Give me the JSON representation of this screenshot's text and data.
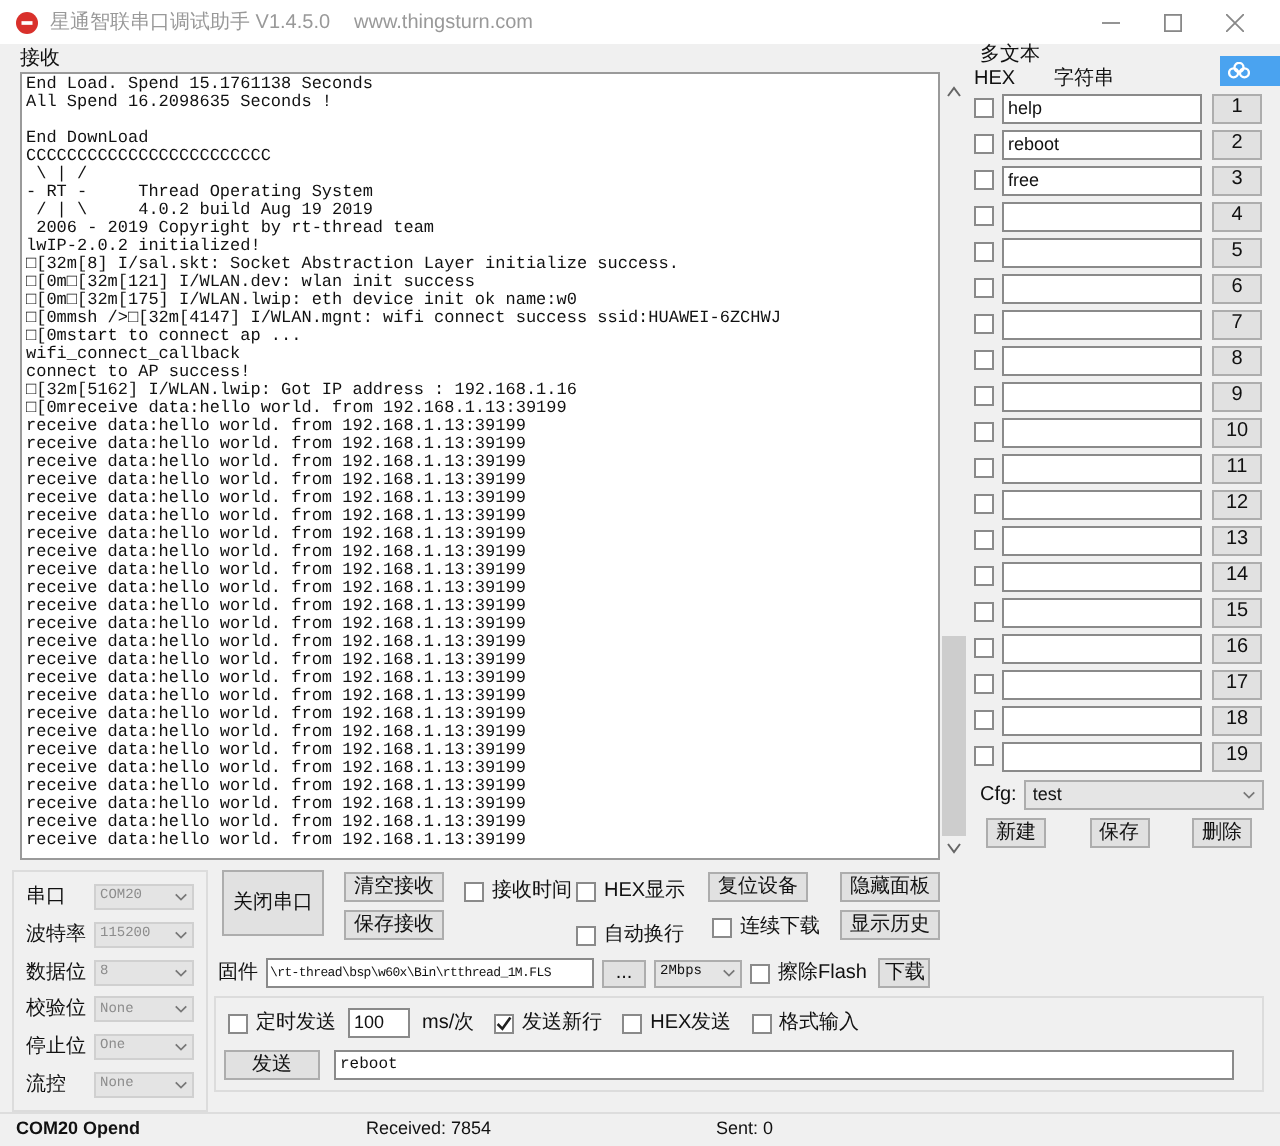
{
  "title_bar": {
    "title": "星通智联串口调试助手 V1.4.5.0",
    "url": "www.thingsturn.com"
  },
  "receive": {
    "label": "接收",
    "log_blocks": [
      [
        "End Load. Spend 15.1761138 Seconds",
        "All Spend 16.2098635 Seconds !"
      ],
      [
        "End DownLoad",
        "CCCCCCCCCCCCCCCCCCCCCCCC",
        " \\ | /",
        "- RT -     Thread Operating System",
        " / | \\     4.0.2 build Aug 19 2019",
        " 2006 - 2019 Copyright by rt-thread team",
        "lwIP-2.0.2 initialized!",
        "□[32m[8] I/sal.skt: Socket Abstraction Layer initialize success.",
        "□[0m□[32m[121] I/WLAN.dev: wlan init success",
        "□[0m□[32m[175] I/WLAN.lwip: eth device init ok name:w0",
        "□[0mmsh />□[32m[4147] I/WLAN.mgnt: wifi connect success ssid:HUAWEI-6ZCHWJ",
        "□[0mstart to connect ap ...",
        "wifi_connect_callback",
        "connect to AP success!",
        "□[32m[5162] I/WLAN.lwip: Got IP address : 192.168.1.16",
        "□[0mreceive data:hello world. from 192.168.1.13:39199",
        "receive data:hello world. from 192.168.1.13:39199",
        "receive data:hello world. from 192.168.1.13:39199",
        "receive data:hello world. from 192.168.1.13:39199",
        "receive data:hello world. from 192.168.1.13:39199",
        "receive data:hello world. from 192.168.1.13:39199",
        "receive data:hello world. from 192.168.1.13:39199",
        "receive data:hello world. from 192.168.1.13:39199",
        "receive data:hello world. from 192.168.1.13:39199",
        "receive data:hello world. from 192.168.1.13:39199",
        "receive data:hello world. from 192.168.1.13:39199",
        "receive data:hello world. from 192.168.1.13:39199",
        "receive data:hello world. from 192.168.1.13:39199",
        "receive data:hello world. from 192.168.1.13:39199",
        "receive data:hello world. from 192.168.1.13:39199",
        "receive data:hello world. from 192.168.1.13:39199",
        "receive data:hello world. from 192.168.1.13:39199",
        "receive data:hello world. from 192.168.1.13:39199",
        "receive data:hello world. from 192.168.1.13:39199",
        "receive data:hello world. from 192.168.1.13:39199",
        "receive data:hello world. from 192.168.1.13:39199",
        "receive data:hello world. from 192.168.1.13:39199",
        "receive data:hello world. from 192.168.1.13:39199",
        "receive data:hello world. from 192.168.1.13:39199",
        "receive data:hello world. from 192.168.1.13:39199"
      ]
    ]
  },
  "multi_text": {
    "title": "多文本",
    "columns": [
      "HEX",
      "字符串"
    ],
    "rows": [
      {
        "hex": false,
        "value": "help",
        "button": "1"
      },
      {
        "hex": false,
        "value": "reboot",
        "button": "2"
      },
      {
        "hex": false,
        "value": "free",
        "button": "3"
      },
      {
        "hex": false,
        "button": "4"
      },
      {
        "hex": false,
        "button": "5"
      },
      {
        "hex": false,
        "button": "6"
      },
      {
        "hex": false,
        "button": "7"
      },
      {
        "hex": false,
        "button": "8"
      },
      {
        "hex": false,
        "button": "9"
      },
      {
        "hex": false,
        "button": "10"
      },
      {
        "hex": false,
        "button": "11"
      },
      {
        "hex": false,
        "button": "12"
      },
      {
        "hex": false,
        "button": "13"
      },
      {
        "hex": false,
        "button": "14"
      },
      {
        "hex": false,
        "button": "15"
      },
      {
        "hex": false,
        "button": "16"
      },
      {
        "hex": false,
        "button": "17"
      },
      {
        "hex": false,
        "button": "18"
      },
      {
        "hex": false,
        "button": "19"
      }
    ],
    "cfg": {
      "label": "Cfg:",
      "value": "test"
    },
    "buttons": [
      "新建",
      "保存",
      "删除"
    ]
  },
  "port_settings": [
    {
      "label": "串口",
      "value": "COM20",
      "disabled": true
    },
    {
      "label": "波特率",
      "value": "115200",
      "disabled": true
    },
    {
      "label": "数据位",
      "value": "8",
      "disabled": true
    },
    {
      "label": "校验位",
      "value": "None",
      "disabled": true
    },
    {
      "label": "停止位",
      "value": "One",
      "disabled": true
    },
    {
      "label": "流控",
      "value": "None",
      "disabled": true
    }
  ],
  "port_button": "关闭串口",
  "receive_buttons": [
    "清空接收",
    "保存接收"
  ],
  "receive_options": [
    {
      "label": "接收时间",
      "checked": false
    },
    {
      "label": "HEX显示",
      "checked": false
    },
    {
      "label": "自动换行",
      "checked": false
    },
    {
      "label": "连续下载",
      "checked": false
    }
  ],
  "device_buttons": [
    "复位设备"
  ],
  "panel_buttons": [
    "隐藏面板",
    "显示历史"
  ],
  "firmware": {
    "label": "固件",
    "path": "\\rt-thread\\bsp\\w60x\\Bin\\rtthread_1M.FLS",
    "browse": "...",
    "speed": "2Mbps",
    "erase": {
      "label": "擦除Flash",
      "checked": false
    },
    "download": "下载"
  },
  "send": {
    "timed": {
      "label": "定时发送",
      "checked": false
    },
    "interval": "100",
    "unit": "ms/次",
    "options": [
      {
        "label": "发送新行",
        "checked": true
      },
      {
        "label": "HEX发送",
        "checked": false
      },
      {
        "label": "格式输入",
        "checked": false
      }
    ],
    "button": "发送",
    "text": "reboot"
  },
  "status_bar": {
    "port": "COM20 Opend",
    "received": "Received: 7854",
    "sent": "Sent: 0"
  }
}
